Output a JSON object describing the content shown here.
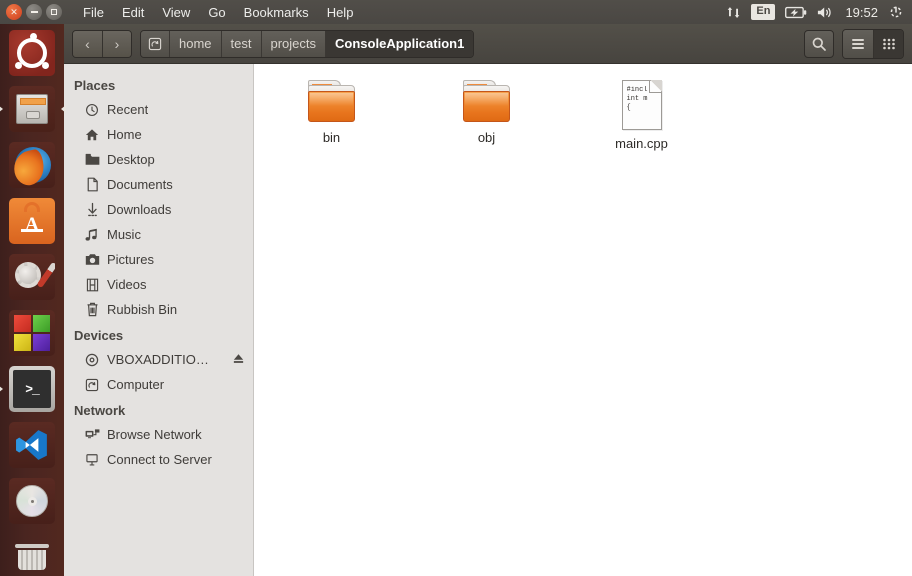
{
  "panel": {
    "window_buttons": [
      {
        "name": "close",
        "glyph": "×"
      },
      {
        "name": "minimize",
        "glyph": "−"
      },
      {
        "name": "maximize",
        "glyph": "□"
      }
    ],
    "menus": [
      "File",
      "Edit",
      "View",
      "Go",
      "Bookmarks",
      "Help"
    ],
    "tray": {
      "network_icon": "network-transfer-icon",
      "keyboard_layout": "En",
      "battery_icon": "battery-icon",
      "volume_icon": "volume-icon",
      "clock": "19:52",
      "session_icon": "power-gear-icon"
    }
  },
  "launcher": {
    "items": [
      {
        "name": "ubuntu-dash",
        "label": "Dash Home",
        "running": false,
        "focused": false
      },
      {
        "name": "files-nautilus",
        "label": "Files",
        "running": true,
        "focused": true
      },
      {
        "name": "firefox",
        "label": "Firefox Web Browser",
        "running": false,
        "focused": false
      },
      {
        "name": "ubuntu-software",
        "label": "Ubuntu Software",
        "running": false,
        "focused": false
      },
      {
        "name": "system-settings",
        "label": "System Settings",
        "running": false,
        "focused": false
      },
      {
        "name": "color-blocks-app",
        "label": "Application",
        "running": false,
        "focused": false
      },
      {
        "name": "terminal",
        "label": "Terminal",
        "running": true,
        "focused": false
      },
      {
        "name": "visual-studio",
        "label": "Visual Studio",
        "running": false,
        "focused": false
      },
      {
        "name": "disc-drive",
        "label": "Disc",
        "running": false,
        "focused": false
      },
      {
        "name": "rubbish-bin",
        "label": "Rubbish Bin",
        "running": false,
        "focused": false
      }
    ]
  },
  "toolbar": {
    "back_glyph": "‹",
    "forward_glyph": "›",
    "breadcrumb": [
      {
        "label": "",
        "icon": "drive-home-icon",
        "active": false
      },
      {
        "label": "home",
        "active": false
      },
      {
        "label": "test",
        "active": false
      },
      {
        "label": "projects",
        "active": false
      },
      {
        "label": "ConsoleApplication1",
        "active": true
      }
    ],
    "search_label": "Search",
    "list_view_label": "List view",
    "icon_view_label": "Icon view",
    "active_view": "icon"
  },
  "sidebar": {
    "sections": [
      {
        "title": "Places",
        "items": [
          {
            "label": "Recent",
            "icon": "clock-icon",
            "eject": false
          },
          {
            "label": "Home",
            "icon": "house-icon",
            "eject": false
          },
          {
            "label": "Desktop",
            "icon": "folder-icon",
            "eject": false
          },
          {
            "label": "Documents",
            "icon": "document-icon",
            "eject": false
          },
          {
            "label": "Downloads",
            "icon": "download-arrow-icon",
            "eject": false
          },
          {
            "label": "Music",
            "icon": "music-note-icon",
            "eject": false
          },
          {
            "label": "Pictures",
            "icon": "camera-icon",
            "eject": false
          },
          {
            "label": "Videos",
            "icon": "film-icon",
            "eject": false
          },
          {
            "label": "Rubbish Bin",
            "icon": "trash-icon",
            "eject": false
          }
        ]
      },
      {
        "title": "Devices",
        "items": [
          {
            "label": "VBOXADDITIO…",
            "icon": "disc-icon",
            "eject": true
          },
          {
            "label": "Computer",
            "icon": "computer-icon",
            "eject": false
          }
        ]
      },
      {
        "title": "Network",
        "items": [
          {
            "label": "Browse Network",
            "icon": "network-browse-icon",
            "eject": false
          },
          {
            "label": "Connect to Server",
            "icon": "server-connect-icon",
            "eject": false
          }
        ]
      }
    ]
  },
  "content": {
    "files": [
      {
        "name": "bin",
        "type": "folder"
      },
      {
        "name": "obj",
        "type": "folder"
      },
      {
        "name": "main.cpp",
        "type": "source-document",
        "preview": [
          "#incl",
          "int m",
          "{"
        ]
      }
    ]
  },
  "colors": {
    "panel": "#4d4a45",
    "launcher": "#4a2520",
    "accent_orange": "#e8751d",
    "sidebar_bg": "#e4e2e0",
    "content_bg": "#ffffff"
  }
}
